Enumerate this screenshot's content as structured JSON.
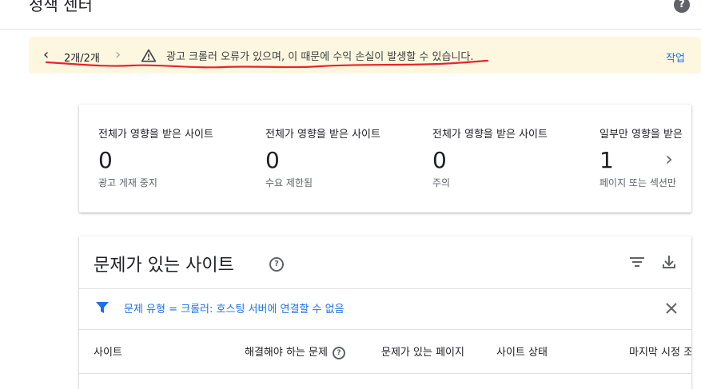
{
  "header": {
    "title": "정책 센터",
    "help_glyph": "?"
  },
  "banner": {
    "prev_icon": "chevron-left-icon",
    "count": "2개/2개",
    "next_icon": "chevron-right-icon",
    "warning_icon": "warning-icon",
    "message": "광고 크롤러 오류가 있으며, 이 때문에 수익 손실이 발생할 수 있습니다.",
    "action": "작업",
    "background": "#fef7e0",
    "annotation_color": "#e8232b"
  },
  "stats": [
    {
      "label": "전체가 영향을 받은 사이트",
      "value": "0",
      "sub": "광고 게재 중지"
    },
    {
      "label": "전체가 영향을 받은 사이트",
      "value": "0",
      "sub": "수요 제한됨"
    },
    {
      "label": "전체가 영향을 받은 사이트",
      "value": "0",
      "sub": "주의"
    },
    {
      "label": "일부만 영향을 받은",
      "value": "1",
      "sub": "페이지 또는 섹션만"
    }
  ],
  "issues": {
    "title": "문제가 있는 사이트",
    "help_glyph": "?",
    "filter_text": "문제 유형 = 크롤러: 호스팅 서버에 연결할 수 없음",
    "columns": [
      "사이트",
      "해결해야 하는 문제",
      "문제가 있는 페이지",
      "사이트 상태",
      "마지막 시정 조"
    ]
  },
  "colors": {
    "accent": "#1a73e8",
    "icon": "#5f6368"
  }
}
